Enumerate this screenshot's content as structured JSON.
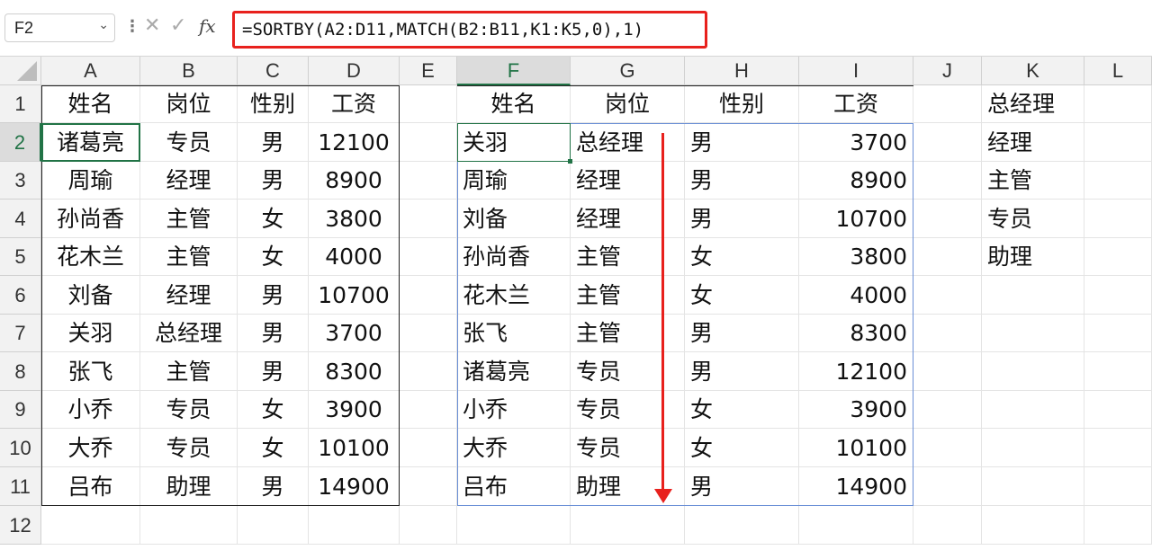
{
  "namebox": {
    "value": "F2"
  },
  "formula_bar": {
    "fx": "fx",
    "formula": "=SORTBY(A2:D11,MATCH(B2:B11,K1:K5,0),1)"
  },
  "columns": [
    "A",
    "B",
    "C",
    "D",
    "E",
    "F",
    "G",
    "H",
    "I",
    "J",
    "K",
    "L"
  ],
  "rows": [
    "1",
    "2",
    "3",
    "4",
    "5",
    "6",
    "7",
    "8",
    "9",
    "10",
    "11",
    "12"
  ],
  "source_table": {
    "headers": [
      "姓名",
      "岗位",
      "性别",
      "工资"
    ],
    "rows": [
      [
        "诸葛亮",
        "专员",
        "男",
        "12100"
      ],
      [
        "周瑜",
        "经理",
        "男",
        "8900"
      ],
      [
        "孙尚香",
        "主管",
        "女",
        "3800"
      ],
      [
        "花木兰",
        "主管",
        "女",
        "4000"
      ],
      [
        "刘备",
        "经理",
        "男",
        "10700"
      ],
      [
        "关羽",
        "总经理",
        "男",
        "3700"
      ],
      [
        "张飞",
        "主管",
        "男",
        "8300"
      ],
      [
        "小乔",
        "专员",
        "女",
        "3900"
      ],
      [
        "大乔",
        "专员",
        "女",
        "10100"
      ],
      [
        "吕布",
        "助理",
        "男",
        "14900"
      ]
    ]
  },
  "sorted_table": {
    "headers": [
      "姓名",
      "岗位",
      "性别",
      "工资"
    ],
    "rows": [
      [
        "关羽",
        "总经理",
        "男",
        "3700"
      ],
      [
        "周瑜",
        "经理",
        "男",
        "8900"
      ],
      [
        "刘备",
        "经理",
        "男",
        "10700"
      ],
      [
        "孙尚香",
        "主管",
        "女",
        "3800"
      ],
      [
        "花木兰",
        "主管",
        "女",
        "4000"
      ],
      [
        "张飞",
        "主管",
        "男",
        "8300"
      ],
      [
        "诸葛亮",
        "专员",
        "男",
        "12100"
      ],
      [
        "小乔",
        "专员",
        "女",
        "3900"
      ],
      [
        "大乔",
        "专员",
        "女",
        "10100"
      ],
      [
        "吕布",
        "助理",
        "男",
        "14900"
      ]
    ]
  },
  "order_list": [
    "总经理",
    "经理",
    "主管",
    "专员",
    "助理"
  ],
  "colors": {
    "highlight": "#e8211d",
    "selection": "#217346",
    "spill_border": "#6a8fd6"
  }
}
